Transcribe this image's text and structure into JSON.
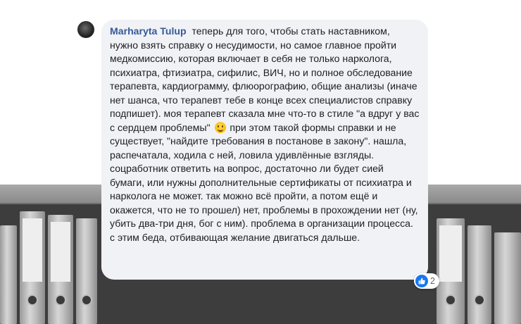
{
  "comment": {
    "author": "Marharyta Tulup",
    "text_before_emoji": "теперь для того, чтобы стать наставником, нужно взять справку о несудимости, но самое главное пройти медкомиссию, которая включает в себя не только нарколога, психиатра, фтизиатра, сифилис, ВИЧ, но и полное обследование терапевта, кардиограмму, флюорографию, общие анализы (иначе нет шанса, что терапевт тебе в конце всех специалистов справку подпишет). моя терапевт сказала мне что-то в стиле \"а вдруг у вас с сердцем проблемы\"",
    "emoji_icon": "smile-emoji-icon",
    "text_after_emoji": "при этом такой формы справки и не существует, \"найдите требования в постанове в закону\". нашла, распечатала, ходила с ней, ловила удивлённые взгляды. соцработник ответить на вопрос, достаточно ли будет сией бумаги, или нужны дополнительные сертификаты от психиатра и нарколога не может. так можно всё пройти, а потом ещё и окажется, что не то прошел) нет, проблемы в прохождении нет (ну, убить два-три дня, бог с ним). проблема в организации процесса. с этим беда, отбивающая желание двигаться дальше.",
    "reaction_icon": "like-icon",
    "reaction_count": "2"
  },
  "colors": {
    "bubble_bg": "#f0f2f5",
    "author_link": "#385898",
    "like_blue": "#1877f2"
  }
}
